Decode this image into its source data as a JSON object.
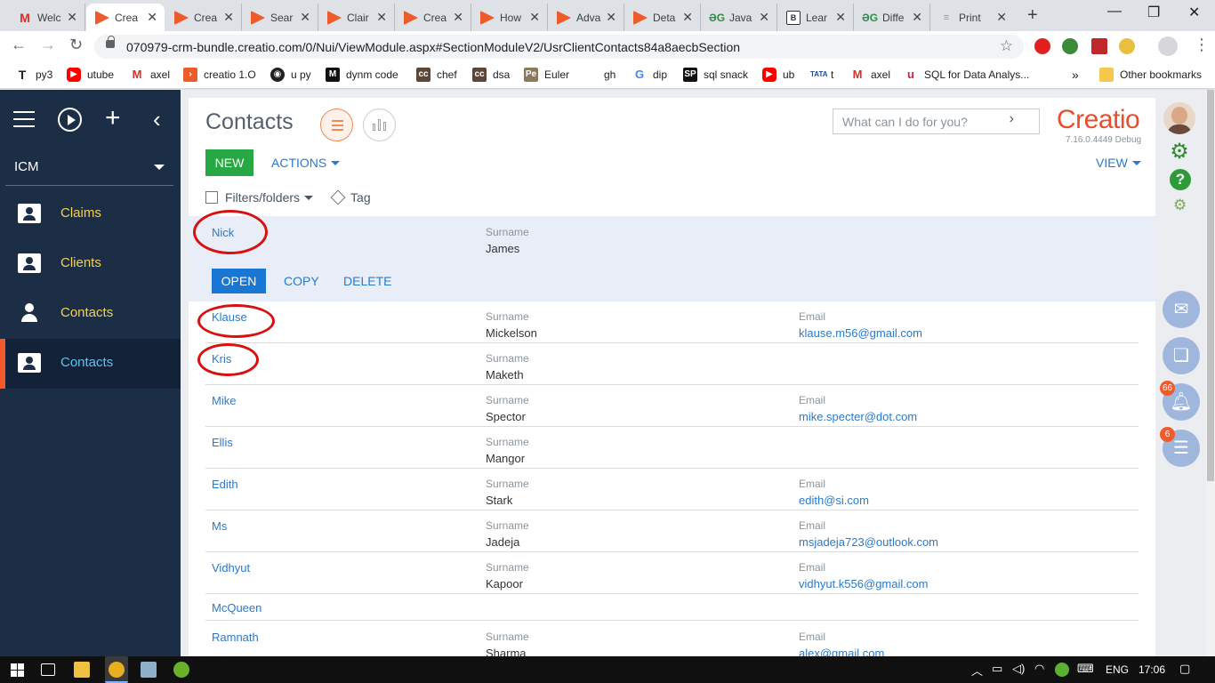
{
  "browser": {
    "tabs": [
      {
        "title": "Welc",
        "favicon": "gmail-icon"
      },
      {
        "title": "Crea",
        "favicon": "creatio-icon"
      },
      {
        "title": "Crea",
        "favicon": "creatio-icon"
      },
      {
        "title": "Sear",
        "favicon": "creatio-icon"
      },
      {
        "title": "Clair",
        "favicon": "creatio-icon"
      },
      {
        "title": "Crea",
        "favicon": "creatio-icon"
      },
      {
        "title": "How",
        "favicon": "creatio-icon"
      },
      {
        "title": "Adva",
        "favicon": "creatio-icon"
      },
      {
        "title": "Deta",
        "favicon": "creatio-icon"
      },
      {
        "title": "Java",
        "favicon": "gfg-icon"
      },
      {
        "title": "Lear",
        "favicon": "shield-icon"
      },
      {
        "title": "Diffe",
        "favicon": "gfg-icon"
      },
      {
        "title": "Print",
        "favicon": "stackoverflow-icon"
      }
    ],
    "url": "070979-crm-bundle.creatio.com/0/Nui/ViewModule.aspx#SectionModuleV2/UsrClientContacts84a8aecbSection",
    "bookmarks": [
      {
        "label": "py3",
        "icon": "text-t-icon"
      },
      {
        "label": "utube",
        "icon": "youtube-icon"
      },
      {
        "label": "axel",
        "icon": "gmail-icon"
      },
      {
        "label": "creatio 1.O",
        "icon": "creatio-icon"
      },
      {
        "label": "u py",
        "icon": "github-icon"
      },
      {
        "label": "dynm code",
        "icon": "medium-icon"
      },
      {
        "label": "chef",
        "icon": "codechef-icon"
      },
      {
        "label": "dsa",
        "icon": "codechef-icon"
      },
      {
        "label": "Euler",
        "icon": "euler-icon"
      },
      {
        "label": "gh",
        "icon": "blank-icon"
      },
      {
        "label": "dip",
        "icon": "google-icon"
      },
      {
        "label": "sql snack",
        "icon": "sp-icon"
      },
      {
        "label": "ub",
        "icon": "youtube-icon"
      },
      {
        "label": "t",
        "icon": "tata-icon"
      },
      {
        "label": "axel",
        "icon": "gmail-icon"
      },
      {
        "label": "SQL for Data Analys...",
        "icon": "udemy-icon"
      }
    ],
    "overflow": "»",
    "other_bookmarks": "Other bookmarks"
  },
  "sidebar": {
    "workspace": "ICM",
    "items": [
      {
        "label": "Claims",
        "icon": "card-person-icon",
        "active": false
      },
      {
        "label": "Clients",
        "icon": "card-person-icon",
        "active": false
      },
      {
        "label": "Contacts",
        "icon": "person-icon",
        "active": false
      },
      {
        "label": "Contacts",
        "icon": "card-person-icon",
        "active": true
      }
    ]
  },
  "header": {
    "title": "Contacts",
    "search_placeholder": "What can I do for you?",
    "logo": "Creatio",
    "version": "7.16.0.4449 Debug"
  },
  "toolbar": {
    "new_label": "NEW",
    "actions_label": "ACTIONS",
    "view_label": "VIEW",
    "filters_label": "Filters/folders",
    "tag_label": "Tag"
  },
  "row_actions": {
    "open": "OPEN",
    "copy": "COPY",
    "delete": "DELETE"
  },
  "contacts": [
    {
      "name": "Nick",
      "surname_label": "Surname",
      "surname": "James",
      "email_label": "",
      "email": "",
      "selected": true,
      "circled": true
    },
    {
      "name": "Klause",
      "surname_label": "Surname",
      "surname": "Mickelson",
      "email_label": "Email",
      "email": "klause.m56@gmail.com",
      "circled": true
    },
    {
      "name": "Kris",
      "surname_label": "Surname",
      "surname": "Maketh",
      "email_label": "",
      "email": "",
      "circled": true
    },
    {
      "name": "Mike",
      "surname_label": "Surname",
      "surname": "Spector",
      "email_label": "Email",
      "email": "mike.specter@dot.com"
    },
    {
      "name": "Ellis",
      "surname_label": "Surname",
      "surname": "Mangor",
      "email_label": "",
      "email": ""
    },
    {
      "name": "Edith",
      "surname_label": "Surname",
      "surname": "Stark",
      "email_label": "Email",
      "email": "edith@si.com"
    },
    {
      "name": "Ms",
      "surname_label": "Surname",
      "surname": "Jadeja",
      "email_label": "Email",
      "email": "msjadeja723@outlook.com"
    },
    {
      "name": "Vidhyut",
      "surname_label": "Surname",
      "surname": "Kapoor",
      "email_label": "Email",
      "email": "vidhyut.k556@gmail.com"
    },
    {
      "name": "McQueen",
      "surname_label": "",
      "surname": "",
      "email_label": "",
      "email": ""
    },
    {
      "name": "Ramnath",
      "surname_label": "Surname",
      "surname": "Sharma",
      "email_label": "Email",
      "email": "alex@gmail.com"
    }
  ],
  "rightbar": {
    "notification_count": "66",
    "task_count": "6"
  },
  "taskbar": {
    "language": "ENG",
    "time": "17:06"
  },
  "colors": {
    "sidebar_bg": "#1c2d46",
    "sidebar_label": "#f6d34a",
    "sidebar_active_label": "#58c6f2",
    "accent": "#f15a2a",
    "link": "#2a7ac8",
    "new_button": "#28a745",
    "open_button": "#1976d2",
    "annotation_circle": "#d81010"
  }
}
